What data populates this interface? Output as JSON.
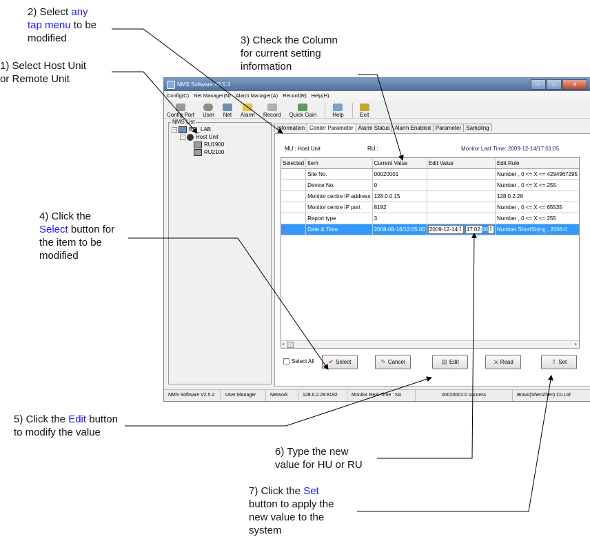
{
  "annotations": {
    "a1_pre": "1) Select Host Unit\nor Remote Unit",
    "a2_pre": "2) Select ",
    "a2_blue1": "any",
    "a2_blue2": "tap menu",
    "a2_post": " to be\nmodified",
    "a3": "3) Check the Column\nfor current setting\ninformation",
    "a4_pre": "4) Click the\n",
    "a4_blue": "Select",
    "a4_post": " button for\nthe item to be\nmodified",
    "a5_pre": "5) Click the ",
    "a5_blue": "Edit",
    "a5_post": " button\nto modify the value",
    "a6_pre": "6) ",
    "a6_post": "Type the new\nvalue for HU or RU",
    "a7_pre": "7) Click the ",
    "a7_blue": "Set",
    "a7_post": "\nbutton to apply the\nnew value to the\nsystem"
  },
  "window": {
    "title": "NMS Software V2.5.3",
    "menu": [
      "Config(C)",
      "Net Manager(N)",
      "Alarm Manager(A)",
      "Record(R)",
      "Help(H)"
    ],
    "toolbar": [
      "Config Port",
      "User",
      "Net",
      "Alarm",
      "Record",
      "Quick Gain",
      "Help",
      "Exit"
    ],
    "nms_list_label": "NMS List",
    "tree": {
      "root": "BTI_LAB",
      "host": "Host Unit",
      "ru1": "RU1900",
      "ru2": "RU2100"
    },
    "tabs": [
      "Information",
      "Center Parameter",
      "Alarm Status",
      "Alarm Enabled",
      "Parameter",
      "Sampling"
    ],
    "info": {
      "mu": "MU : Host Unit",
      "ru": "RU :",
      "monitor": "Monitor Last Time: 2009-12-14/17:01:05"
    },
    "columns": [
      "Selected",
      "Item",
      "Current Value",
      "Edit Value",
      "Edit Rule"
    ],
    "rows": [
      {
        "selected": "",
        "item": "Site No.",
        "current": "00020001",
        "edit": "",
        "rule": "Number , 0 <= X <= 4294967295"
      },
      {
        "selected": "",
        "item": "Device No.",
        "current": "0",
        "edit": "",
        "rule": "Number , 0 <= X <= 255"
      },
      {
        "selected": "",
        "item": "Monitor centre IP address",
        "current": "128.0.0.15",
        "edit": "",
        "rule": "128.0.2.28"
      },
      {
        "selected": "",
        "item": "Monitor centre IP port",
        "current": "8192",
        "edit": "",
        "rule": "Number , 0 <= X <= 65535"
      },
      {
        "selected": "",
        "item": "Report type",
        "current": "3",
        "edit": "",
        "rule": "Number , 0 <= X <= 255"
      }
    ],
    "selected_row": {
      "selected": "E",
      "item": "Date & Time",
      "current": "2008-08-16/12:05:00",
      "edit_date": "2009-12-14",
      "edit_time": "17:02:",
      "edit_time_sel": "00",
      "rule": "Number ShortString , 2006-0"
    },
    "select_all": "Select All",
    "buttons": {
      "select": "Select",
      "cancel": "Cancel",
      "edit": "Edit",
      "read": "Read",
      "set": "Set"
    },
    "status": [
      "NMS Software V2.5.2",
      "User:Manager",
      "Network",
      "128.0.2.28:8192",
      "Monitor Real-Time : No",
      "00020001:0 success",
      "Bravo(ShenZhen) Co.Ltd"
    ]
  }
}
